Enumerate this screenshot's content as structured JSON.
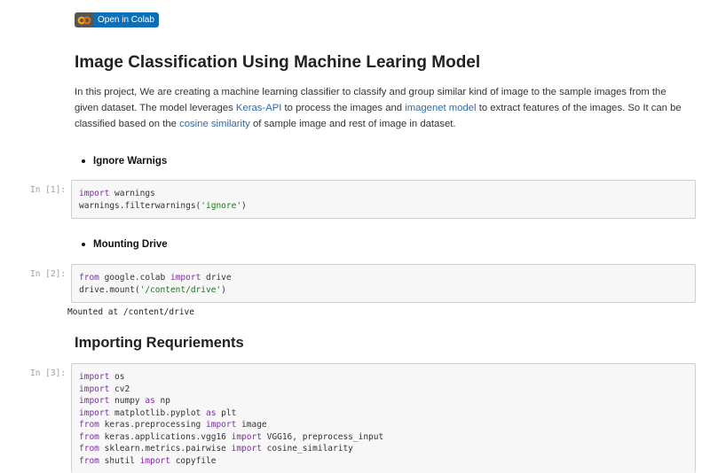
{
  "badge": {
    "label": "Open in Colab",
    "icon": "colab-logo-icon",
    "color": "#0b6fb8"
  },
  "title": "Image Classification Using Machine Learing Model",
  "intro": {
    "part1": "In this project, We are creating a machine learning classifier to classify and group similar kind of image to the sample images from the given dataset. The model leverages ",
    "link1": "Keras-API",
    "part2": " to process the images and ",
    "link2": "imagenet model",
    "part3": " to extract features of the images. So It can be classified based on the ",
    "link3": "cosine similarity",
    "part4": " of sample image and rest of image in dataset."
  },
  "section1": {
    "label": "Ignore Warnigs"
  },
  "cell1": {
    "prompt": "In [1]:",
    "lines": [
      {
        "kw": "import",
        "rest": " warnings"
      },
      {
        "pre": "warnings.filterwarnings(",
        "str": "'ignore'",
        "post": ")"
      }
    ]
  },
  "section2": {
    "label": "Mounting Drive"
  },
  "cell2": {
    "prompt": "In [2]:",
    "lines": [
      {
        "a": "from",
        "b": " google.colab ",
        "c": "import",
        "d": " drive"
      },
      {
        "pre": "drive.mount(",
        "str": "'/content/drive'",
        "post": ")"
      }
    ],
    "output": "Mounted at /content/drive"
  },
  "heading2": "Importing Requriements",
  "cell3": {
    "prompt": "In [3]:",
    "lines": [
      {
        "a": "import",
        "b": " os"
      },
      {
        "a": "import",
        "b": " cv2"
      },
      {
        "a": "import",
        "b": " numpy ",
        "c": "as",
        "d": " np"
      },
      {
        "a": "import",
        "b": " matplotlib.pyplot ",
        "c": "as",
        "d": " plt"
      },
      {
        "a": "from",
        "b": " keras.preprocessing ",
        "c": "import",
        "d": " image"
      },
      {
        "a": "from",
        "b": " keras.applications.vgg16 ",
        "c": "import",
        "d": " VGG16, preprocess_input"
      },
      {
        "a": "from",
        "b": " sklearn.metrics.pairwise ",
        "c": "import",
        "d": " cosine_similarity"
      },
      {
        "a": "from",
        "b": " shutil ",
        "c": "import",
        "d": " copyfile"
      }
    ]
  }
}
